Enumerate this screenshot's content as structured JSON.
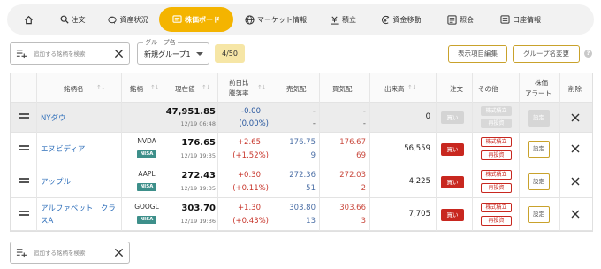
{
  "nav": {
    "items": [
      {
        "label": "",
        "icon": "home-icon"
      },
      {
        "label": "注文",
        "icon": "search-icon"
      },
      {
        "label": "資産状況",
        "icon": "piggy-bank-icon"
      },
      {
        "label": "株価ボード",
        "icon": "board-icon",
        "active": true
      },
      {
        "label": "マーケット情報",
        "icon": "globe-icon"
      },
      {
        "label": "積立",
        "icon": "coins-icon"
      },
      {
        "label": "資金移動",
        "icon": "yen-transfer-icon"
      },
      {
        "label": "照会",
        "icon": "inquiry-icon"
      },
      {
        "label": "口座情報",
        "icon": "account-icon"
      }
    ]
  },
  "toolbar": {
    "search_placeholder": "追加する銘柄を検索",
    "group_label": "グループ名",
    "group_value": "新規グループ1",
    "count": "4/50",
    "edit_columns": "表示項目編集",
    "rename_group": "グループ名変更",
    "help": "?"
  },
  "table": {
    "headers": {
      "name": "銘柄名",
      "code": "銘柄",
      "price": "現在値",
      "change_1": "前日比",
      "change_2": "騰落率",
      "ask": "売気配",
      "bid": "買気配",
      "volume": "出来高",
      "order": "注文",
      "other": "その他",
      "alert_1": "株価",
      "alert_2": "アラート",
      "delete": "削除"
    },
    "rows": [
      {
        "name_1": "NYダウ",
        "name_2": "",
        "code": "",
        "nisa": "",
        "price": "47,951.85",
        "time": "12/19 06:48",
        "change": "-0.00",
        "change_pct": "(0.00%)",
        "ask_price": "-",
        "ask_qty": "-",
        "bid_price": "-",
        "bid_qty": "-",
        "volume": "0",
        "buy": "買い",
        "btn_tsumitate": "株式積立",
        "btn_reinvest": "再投資",
        "setting": "設定",
        "enabled": false
      },
      {
        "name_1": "エヌビディア",
        "name_2": "",
        "code": "NVDA",
        "nisa": "NISA",
        "price": "176.65",
        "time": "12/19 19:35",
        "change": "+2.65",
        "change_pct": "(+1.52%)",
        "ask_price": "176.75",
        "ask_qty": "9",
        "bid_price": "176.67",
        "bid_qty": "69",
        "volume": "56,559",
        "buy": "買い",
        "btn_tsumitate": "株式積立",
        "btn_reinvest": "再投資",
        "setting": "設定",
        "enabled": true
      },
      {
        "name_1": "アップル",
        "name_2": "",
        "code": "AAPL",
        "nisa": "NISA",
        "price": "272.43",
        "time": "12/19 19:35",
        "change": "+0.30",
        "change_pct": "(+0.11%)",
        "ask_price": "272.36",
        "ask_qty": "51",
        "bid_price": "272.03",
        "bid_qty": "2",
        "volume": "4,225",
        "buy": "買い",
        "btn_tsumitate": "株式積立",
        "btn_reinvest": "再投資",
        "setting": "設定",
        "enabled": true
      },
      {
        "name_1": "アルファベット　クラ",
        "name_2": "スA",
        "code": "GOOGL",
        "nisa": "NISA",
        "price": "303.70",
        "time": "12/19 19:36",
        "change": "+1.30",
        "change_pct": "(+0.43%)",
        "ask_price": "303.80",
        "ask_qty": "13",
        "bid_price": "303.66",
        "bid_qty": "3",
        "volume": "7,705",
        "buy": "買い",
        "btn_tsumitate": "株式積立",
        "btn_reinvest": "再投資",
        "setting": "設定",
        "enabled": true
      }
    ]
  },
  "bottom": {
    "search_placeholder": "追加する銘柄を検索"
  },
  "colors": {
    "accent": "#f4b400",
    "positive": "#c8372d",
    "neutral": "#2c5aa0",
    "nisa": "#3d8f8a",
    "buy": "#c8271f"
  }
}
